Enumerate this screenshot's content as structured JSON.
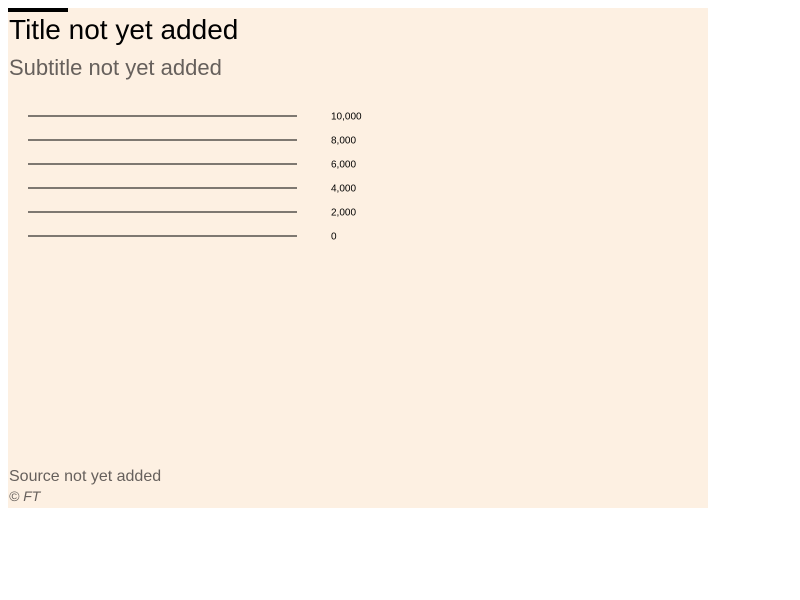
{
  "header": {
    "title": "Title not yet added",
    "subtitle": "Subtitle not yet added"
  },
  "footer": {
    "source": "Source not yet added",
    "copyright": "© FT"
  },
  "colors": {
    "background": "#fdf0e2",
    "text": "#000000",
    "muted_text": "#66605c",
    "gridline": "#000000"
  },
  "chart_data": {
    "type": "line",
    "title": "Title not yet added",
    "subtitle": "Subtitle not yet added",
    "xlabel": "",
    "ylabel": "",
    "ylim": [
      0,
      10000
    ],
    "yticks": [
      10000,
      8000,
      6000,
      4000,
      2000,
      0
    ],
    "ytick_labels": [
      "10,000",
      "8,000",
      "6,000",
      "4,000",
      "2,000",
      "0"
    ],
    "ytick_position": "right",
    "grid": true,
    "series": []
  }
}
